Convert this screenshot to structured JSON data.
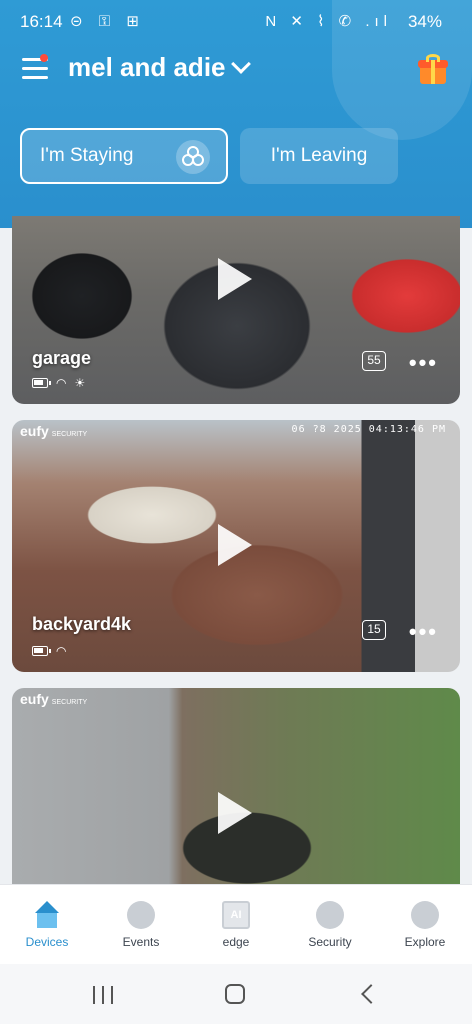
{
  "status_bar": {
    "time": "16:14",
    "left_icons": "⊝ ⚿ ⊞",
    "right_icons": "N ✕ ⌇ ✆ .ıl",
    "battery": "34%"
  },
  "header": {
    "title": "mel and adie",
    "staying_label": "I'm Staying",
    "leaving_label": "I'm Leaving"
  },
  "cameras": [
    {
      "name": "garage",
      "event_count": "55",
      "more": "•••",
      "brand": "",
      "timestamp": ""
    },
    {
      "name": "backyard4k",
      "event_count": "15",
      "more": "•••",
      "brand": "eufy",
      "brand_sub": "SECURITY",
      "timestamp": "06 ?8 2025 04:13:46 PM"
    },
    {
      "name": "",
      "brand": "eufy",
      "brand_sub": "SECURITY"
    }
  ],
  "bottom_nav": [
    {
      "label": "Devices",
      "active": true
    },
    {
      "label": "Events"
    },
    {
      "label": "edge",
      "icon_text": "AI"
    },
    {
      "label": "Security"
    },
    {
      "label": "Explore"
    }
  ],
  "colors": {
    "accent": "#2a8fcd",
    "header": "#2f9bd5"
  }
}
